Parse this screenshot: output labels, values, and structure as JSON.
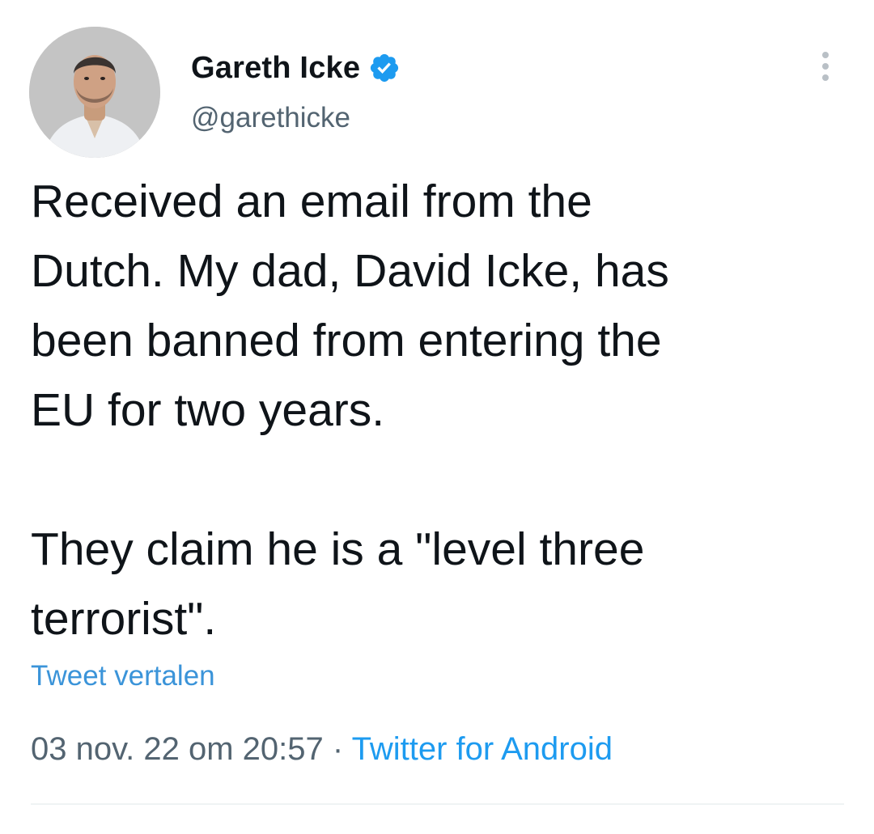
{
  "author": {
    "display_name": "Gareth Icke",
    "handle": "@garethicke",
    "verified_icon": "verified-badge-icon",
    "avatar_icon": "profile-photo"
  },
  "tweet": {
    "text": "Received an email from the\nDutch. My dad, David Icke, has\nbeen banned from entering the\nEU for two years.\n\nThey claim he is a \"level three\nterrorist\".",
    "translate_label": "Tweet vertalen",
    "timestamp": "03 nov. 22 om 20:57",
    "separator": "·",
    "source": "Twitter for Android"
  },
  "colors": {
    "link": "#1d9bf0",
    "secondary_text": "#536471",
    "primary_text": "#0f1419",
    "verified": "#1d9bf0"
  }
}
